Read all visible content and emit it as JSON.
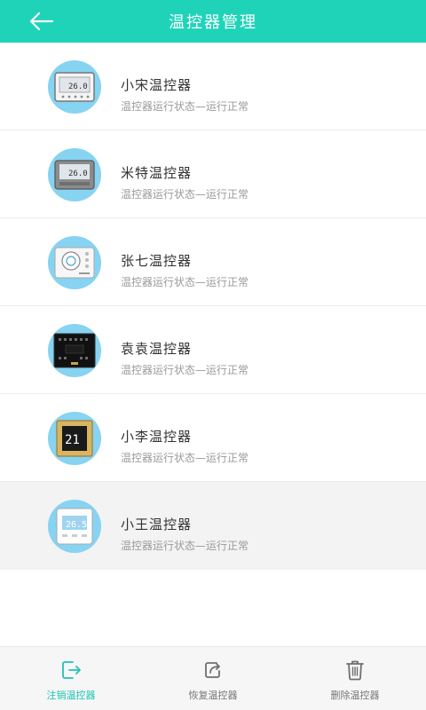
{
  "header": {
    "title": "温控器管理",
    "back_icon": "arrow-left-icon"
  },
  "colors": {
    "accent": "#1fd3b9",
    "avatar_bg": "#87d3f2",
    "active_tab": "#1fc4b3",
    "selected_row_bg": "#f3f3f3"
  },
  "devices": [
    {
      "name": "小宋温控器",
      "status": "温控器运行状态—运行正常",
      "display": "26.0",
      "style": "white"
    },
    {
      "name": "米特温控器",
      "status": "温控器运行状态—运行正常",
      "display": "26.0",
      "style": "grey"
    },
    {
      "name": "张七温控器",
      "status": "温控器运行状态—运行正常",
      "display": "",
      "style": "round"
    },
    {
      "name": "袁袁温控器",
      "status": "温控器运行状态—运行正常",
      "display": "",
      "style": "black"
    },
    {
      "name": "小李温控器",
      "status": "温控器运行状态—运行正常",
      "display": "21",
      "style": "gold"
    },
    {
      "name": "小王温控器",
      "status": "温控器运行状态—运行正常",
      "display": "26.5",
      "style": "white-blue"
    }
  ],
  "selected_device_index": 5,
  "bottom_bar": {
    "tabs": [
      {
        "label": "注销温控器",
        "icon": "logout-icon",
        "active": true
      },
      {
        "label": "恢复温控器",
        "icon": "restore-icon",
        "active": false
      },
      {
        "label": "删除温控器",
        "icon": "trash-icon",
        "active": false
      }
    ]
  }
}
